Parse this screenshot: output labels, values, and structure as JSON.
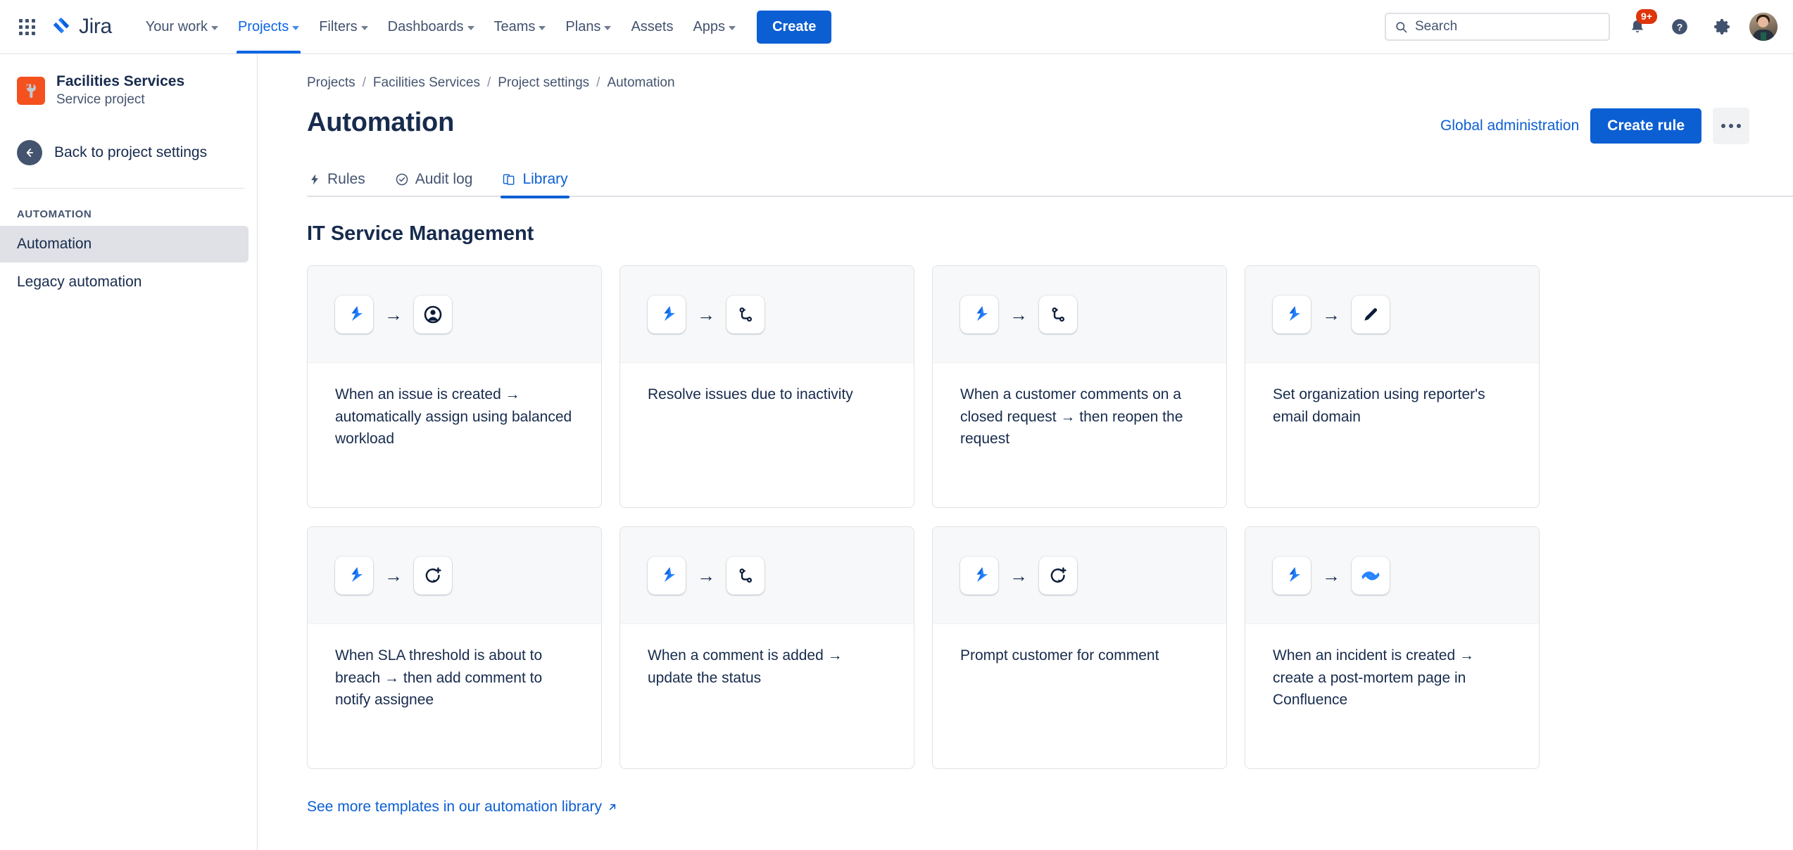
{
  "topnav": {
    "app_switcher": "apps-grid-icon",
    "brand": "Jira",
    "items": [
      {
        "label": "Your work",
        "caret": true,
        "active": false
      },
      {
        "label": "Projects",
        "caret": true,
        "active": true
      },
      {
        "label": "Filters",
        "caret": true,
        "active": false
      },
      {
        "label": "Dashboards",
        "caret": true,
        "active": false
      },
      {
        "label": "Teams",
        "caret": true,
        "active": false
      },
      {
        "label": "Plans",
        "caret": true,
        "active": false
      },
      {
        "label": "Assets",
        "caret": false,
        "active": false
      },
      {
        "label": "Apps",
        "caret": true,
        "active": false
      }
    ],
    "create_label": "Create",
    "search": {
      "placeholder": "Search"
    },
    "notifications_badge": "9+",
    "help_icon": "help-icon",
    "settings_icon": "gear-icon",
    "avatar": "user-avatar"
  },
  "sidebar": {
    "project_name": "Facilities Services",
    "project_type": "Service project",
    "back_label": "Back to project settings",
    "section_title": "Automation",
    "items": [
      {
        "label": "Automation",
        "selected": true
      },
      {
        "label": "Legacy automation",
        "selected": false
      }
    ]
  },
  "breadcrumb": [
    {
      "label": "Projects"
    },
    {
      "label": "Facilities Services"
    },
    {
      "label": "Project settings"
    },
    {
      "label": "Automation"
    }
  ],
  "page": {
    "title": "Automation",
    "global_admin_label": "Global administration",
    "create_rule_label": "Create rule",
    "more_actions": "more-actions-icon"
  },
  "tabs": [
    {
      "label": "Rules",
      "icon": "bolt-icon",
      "active": false
    },
    {
      "label": "Audit log",
      "icon": "check-circle-icon",
      "active": false
    },
    {
      "label": "Library",
      "icon": "copy-pages-icon",
      "active": true
    }
  ],
  "library": {
    "section_title": "IT Service Management",
    "more_templates_label": "See more templates in our automation library",
    "more_templates_icon": "external-link-arrow-icon",
    "cards": [
      {
        "trigger_icon": "jira-bolt-icon",
        "arrow": "→",
        "action_icon": "assignee-person-icon",
        "text": "When an issue is created → automatically assign using balanced workload"
      },
      {
        "trigger_icon": "jira-bolt-icon",
        "arrow": "→",
        "action_icon": "transition-path-icon",
        "text": "Resolve issues due to inactivity"
      },
      {
        "trigger_icon": "jira-bolt-icon",
        "arrow": "→",
        "action_icon": "transition-path-icon",
        "text": "When a customer comments on a closed request → then reopen the request"
      },
      {
        "trigger_icon": "jira-bolt-icon",
        "arrow": "→",
        "action_icon": "edit-pencil-icon",
        "text": "Set organization using reporter's email domain"
      },
      {
        "trigger_icon": "jira-bolt-icon",
        "arrow": "→",
        "action_icon": "add-comment-icon",
        "text": "When SLA threshold is about to breach → then add comment to notify assignee"
      },
      {
        "trigger_icon": "jira-bolt-icon",
        "arrow": "→",
        "action_icon": "transition-path-icon",
        "text": "When a comment is added → update the status"
      },
      {
        "trigger_icon": "jira-bolt-icon",
        "arrow": "→",
        "action_icon": "add-comment-icon",
        "text": "Prompt customer for comment"
      },
      {
        "trigger_icon": "jira-bolt-icon",
        "arrow": "→",
        "action_icon": "confluence-icon",
        "text": "When an incident is created → create a post-mortem page in Confluence"
      }
    ]
  },
  "colors": {
    "brand_blue": "#0C5FD3",
    "link_blue": "#0C66E4",
    "text": "#172B4D",
    "muted": "#44546F",
    "border": "#DFE1E6",
    "card_head_bg": "#F7F8F9",
    "badge_red": "#DE350B",
    "project_avatar": "#F4511E"
  }
}
